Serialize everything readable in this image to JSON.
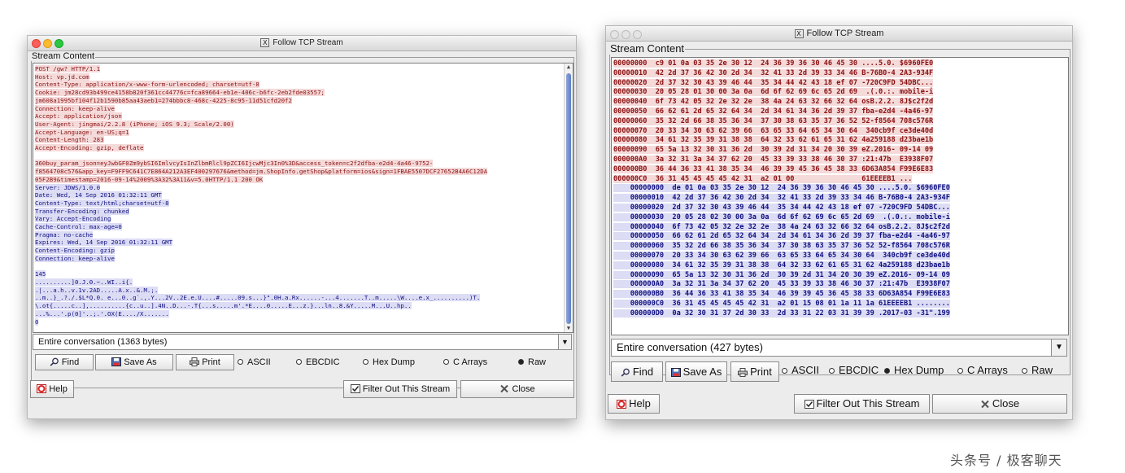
{
  "window_left": {
    "title": "Follow TCP Stream",
    "group_label": "Stream Content",
    "stream_lines": [
      {
        "t": "POST /gw? HTTP/1.1",
        "k": "c"
      },
      {
        "t": "Host: vp.jd.com",
        "k": "c"
      },
      {
        "t": "Content-Type: application/x-www-form-urlencoded; charset=utf-8",
        "k": "c"
      },
      {
        "t": "Cookie: jm28cd93b499ce4158b820f361cc44776c=fca89664-eb1e-406c-b6fc-2eb2fde03557;",
        "k": "c"
      },
      {
        "t": "jm608a1995bf104f12b1590b85aa43aeb1=274bbbc8-468c-4225-8c95-11d51cfd20f2",
        "k": "c"
      },
      {
        "t": "Connection: keep-alive",
        "k": "c"
      },
      {
        "t": "Accept: application/json",
        "k": "c"
      },
      {
        "t": "User-Agent: jingmai/2.2.8 (iPhone; iOS 9.3; Scale/2.00)",
        "k": "c"
      },
      {
        "t": "Accept-Language: en-US;q=1",
        "k": "c"
      },
      {
        "t": "Content-Length: 283",
        "k": "c"
      },
      {
        "t": "Accept-Encoding: gzip, deflate",
        "k": "c"
      },
      {
        "t": "",
        "k": ""
      },
      {
        "t": "360buy_param_json=eyJwbGF0Zm9ybSI6ImlvcyIsInZlbmRlcl9pZCI6IjcwMjc3In0%3D&access_token=c2f2dfba-e2d4-4a46-9752-",
        "k": "c"
      },
      {
        "t": "f8564708c576&app_key=F9FF9C641C7E864A212A3EF400297676&method=jm.ShopInfo.getShop&platform=ios&sign=1FBAE5507DCF27652B4A6C12DA",
        "k": "c"
      },
      {
        "t": "05F2B9&timestamp=2016-09-14%2009%3A32%3A11&v=5.0HTTP/1.1 200 OK",
        "k": "c"
      },
      {
        "t": "Server: JDWS/1.0.0",
        "k": "s"
      },
      {
        "t": "Date: Wed, 14 Sep 2016 01:32:11 GMT",
        "k": "s"
      },
      {
        "t": "Content-Type: text/html;charset=utf-8",
        "k": "s"
      },
      {
        "t": "Transfer-Encoding: chunked",
        "k": "s"
      },
      {
        "t": "Vary: Accept-Encoding",
        "k": "s"
      },
      {
        "t": "Cache-Control: max-age=0",
        "k": "s"
      },
      {
        "t": "Pragma: no-cache",
        "k": "s"
      },
      {
        "t": "Expires: Wed, 14 Sep 2016 01:32:11 GMT",
        "k": "s"
      },
      {
        "t": "Content-Encoding: gzip",
        "k": "s"
      },
      {
        "t": "Connection: keep-alive",
        "k": "s"
      },
      {
        "t": "",
        "k": ""
      },
      {
        "t": "145",
        "k": "s"
      },
      {
        "t": "..........]0.J.0.~..WI..i{.",
        "k": "s"
      },
      {
        "t": ".|...a.h..v.1v.2AD.....A.x..&.M.;.",
        "k": "s"
      },
      {
        "t": "..m..}_.?./.$L*Q.0. e...0..g`.,.Y...2V..2E.e.U....#.....09.s...}\".0H.a.Rx......-...4.......T..m.....\\W....e.x_..........)T.",
        "k": "s"
      },
      {
        "t": "\\.ot{.....c..],..........{c..u..].4N..D...-.T{...s.....m'.*E....0.....E...z.}...ln..8.&Y.....M...U..hp..",
        "k": "s"
      },
      {
        "t": "...%...'.p(0]'..;.'.OX(E..../X.......",
        "k": "s"
      },
      {
        "t": "0",
        "k": "s"
      }
    ],
    "combo_value": "Entire conversation (1363 bytes)",
    "buttons": {
      "find": "Find",
      "save_as": "Save As",
      "print": "Print",
      "help": "Help",
      "filter": "Filter Out This Stream",
      "close": "Close"
    },
    "radios": [
      {
        "label": "ASCII",
        "selected": false
      },
      {
        "label": "EBCDIC",
        "selected": false
      },
      {
        "label": "Hex Dump",
        "selected": false
      },
      {
        "label": "C Arrays",
        "selected": false
      },
      {
        "label": "Raw",
        "selected": true
      }
    ]
  },
  "window_right": {
    "title": "Follow TCP Stream",
    "group_label": "Stream Content",
    "client_lines": [
      "00000000  c9 01 0a 03 35 2e 30 12  24 36 39 36 30 46 45 30 ....5.0. $6960FE0",
      "00000010  42 2d 37 36 42 30 2d 34  32 41 33 2d 39 33 34 46 B-76B0-4 2A3-934F",
      "00000020  2d 37 32 30 43 39 46 44  35 34 44 42 43 18 ef 07 -720C9FD 54DBC...",
      "00000030  20 05 28 01 30 00 3a 0a  6d 6f 62 69 6c 65 2d 69  .(.0.:. mobile-i",
      "00000040  6f 73 42 05 32 2e 32 2e  38 4a 24 63 32 66 32 64 osB.2.2. 8J$c2f2d",
      "00000050  66 62 61 2d 65 32 64 34  2d 34 61 34 36 2d 39 37 fba-e2d4 -4a46-97",
      "00000060  35 32 2d 66 38 35 36 34  37 30 38 63 35 37 36 52 52-f8564 708c576R",
      "00000070  20 33 34 30 63 62 39 66  63 65 33 64 65 34 30 64  340cb9f ce3de40d",
      "00000080  34 61 32 35 39 31 38 38  64 32 33 62 61 65 31 62 4a259188 d23bae1b",
      "00000090  65 5a 13 32 30 31 36 2d  30 39 2d 31 34 20 30 39 eZ.2016- 09-14 09",
      "000000A0  3a 32 31 3a 34 37 62 20  45 33 39 33 38 46 30 37 :21:47b  E3938F07",
      "000000B0  36 44 36 33 41 38 35 34  46 39 39 45 36 45 38 33 6D63A854 F99E6E83",
      "000000C0  36 31 45 45 45 45 42 31  a2 01 00                61EEEEB1 ..."
    ],
    "server_lines": [
      "    00000000  de 01 0a 03 35 2e 30 12  24 36 39 36 30 46 45 30 ....5.0. $6960FE0",
      "    00000010  42 2d 37 36 42 30 2d 34  32 41 33 2d 39 33 34 46 B-76B0-4 2A3-934F",
      "    00000020  2d 37 32 30 43 39 46 44  35 34 44 42 43 18 ef 07 -720C9FD 54DBC...",
      "    00000030  20 05 28 02 30 00 3a 0a  6d 6f 62 69 6c 65 2d 69  .(.0.:. mobile-i",
      "    00000040  6f 73 42 05 32 2e 32 2e  38 4a 24 63 32 66 32 64 osB.2.2. 8J$c2f2d",
      "    00000050  66 62 61 2d 65 32 64 34  2d 34 61 34 36 2d 39 37 fba-e2d4 -4a46-97",
      "    00000060  35 32 2d 66 38 35 36 34  37 30 38 63 35 37 36 52 52-f8564 708c576R",
      "    00000070  20 33 34 30 63 62 39 66  63 65 33 64 65 34 30 64  340cb9f ce3de40d",
      "    00000080  34 61 32 35 39 31 38 38  64 32 33 62 61 65 31 62 4a259188 d23bae1b",
      "    00000090  65 5a 13 32 30 31 36 2d  30 39 2d 31 34 20 30 39 eZ.2016- 09-14 09",
      "    000000A0  3a 32 31 3a 34 37 62 20  45 33 39 33 38 46 30 37 :21:47b  E3938F07",
      "    000000B0  36 44 36 33 41 38 35 34  46 39 39 45 36 45 38 33 6D63A854 F99E6E83",
      "    000000C0  36 31 45 45 45 45 42 31  a2 01 15 08 01 1a 11 1a 61EEEEB1 ........",
      "    000000D0  0a 32 30 31 37 2d 30 33  2d 33 31 22 03 31 39 39 .2017-03 -31\".199"
    ],
    "combo_value": "Entire conversation (427 bytes)",
    "buttons": {
      "find": "Find",
      "save_as": "Save As",
      "print": "Print",
      "help": "Help",
      "filter": "Filter Out This Stream",
      "close": "Close"
    },
    "radios": [
      {
        "label": "ASCII",
        "selected": false
      },
      {
        "label": "EBCDIC",
        "selected": false
      },
      {
        "label": "Hex Dump",
        "selected": true
      },
      {
        "label": "C Arrays",
        "selected": false
      },
      {
        "label": "Raw",
        "selected": false
      }
    ]
  },
  "watermark": "头条号 / 极客聊天",
  "colors": {
    "client_bg": "#f5dada",
    "client_fg": "#8a1010",
    "server_bg": "#dcdcf5",
    "server_fg": "#101080"
  },
  "icons": {
    "find": "magnifier-icon",
    "save_as": "floppy-save-icon",
    "print": "printer-icon",
    "help": "help-lifebuoy-icon",
    "filter": "filter-checkbox-icon",
    "close": "close-x-icon"
  }
}
